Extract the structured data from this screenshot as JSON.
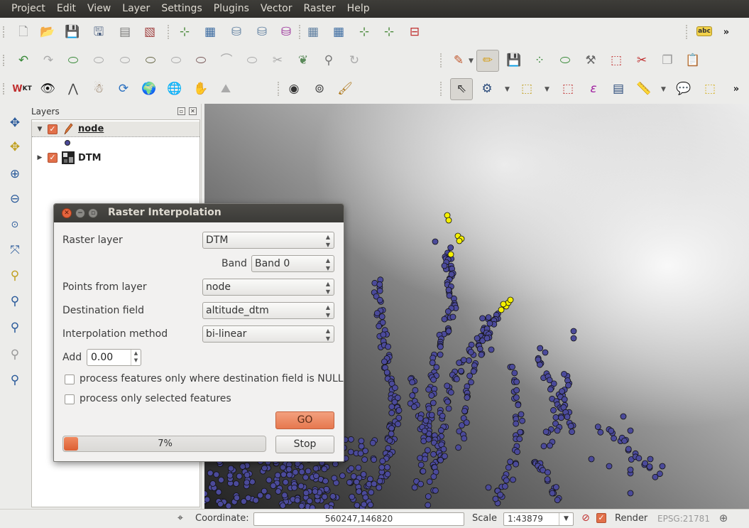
{
  "menubar": {
    "items": [
      "Project",
      "Edit",
      "View",
      "Layer",
      "Settings",
      "Plugins",
      "Vector",
      "Raster",
      "Help"
    ]
  },
  "toolbars": {
    "row1_icons": [
      "new-project-icon",
      "open-project-icon",
      "save-project-icon",
      "save-as-icon",
      "new-print-composer-icon",
      "composer-manager-icon",
      "new-shapefile-layer-icon",
      "add-vector-layer-icon",
      "add-raster-layer-icon",
      "add-postgis-layer-icon",
      "add-spatialite-layer-icon",
      "add-wms-layer-icon",
      "add-wfs-layer-icon",
      "add-delimited-text-icon",
      "new-gpx-layer-icon",
      "remove-layer-icon"
    ],
    "row1_right_icons": [
      "label-tool-icon"
    ],
    "row2_icons": [
      "undo-icon",
      "redo-icon",
      "add-ring-icon",
      "add-part-icon",
      "fill-ring-icon",
      "delete-ring-icon",
      "delete-part-icon",
      "reshape-features-icon",
      "offset-curve-icon",
      "split-features-icon",
      "split-parts-icon",
      "merge-features-icon",
      "merge-attributes-icon",
      "rotate-point-symbols-icon"
    ],
    "row2_right_icons": [
      "current-edits-icon",
      "toggle-editing-icon",
      "save-edits-icon",
      "add-feature-icon",
      "move-feature-icon",
      "node-tool-icon",
      "delete-selected-icon",
      "cut-features-icon",
      "copy-features-icon",
      "paste-features-icon"
    ],
    "row3_icons": [
      "wkt-icon",
      "eye-icon",
      "compass-icon",
      "digitizer-person-icon",
      "refresh-icon",
      "globe-tool-icon",
      "globe-icon",
      "plugin-icon",
      "terrain-icon",
      "gps-icon",
      "rgb-compositor-icon",
      "brush-icon"
    ],
    "row3_right_icons": [
      "identify-icon",
      "run-feature-action-icon",
      "select-features-icon",
      "deselect-icon",
      "select-by-expression-icon",
      "attribute-table-icon",
      "measure-icon",
      "map-tips-icon",
      "new-bookmark-icon"
    ],
    "left_icons": [
      "pan-map-icon",
      "pan-to-selection-icon",
      "zoom-in-icon",
      "zoom-out-icon",
      "zoom-actual-size-icon",
      "zoom-full-icon",
      "zoom-to-selection-icon",
      "zoom-to-layer-icon",
      "zoom-last-icon",
      "zoom-next-icon",
      "refresh-map-icon"
    ],
    "abc_label": "abc"
  },
  "layers_panel": {
    "title": "Layers",
    "layers": [
      {
        "name": "node",
        "checked": true,
        "expanded": true,
        "icon": "pencil-edit-icon"
      },
      {
        "name": "DTM",
        "checked": true,
        "expanded": false,
        "icon": "raster-thumbnail-icon"
      }
    ]
  },
  "dialog": {
    "title": "Raster Interpolation",
    "raster_layer_label": "Raster layer",
    "raster_layer_value": "DTM",
    "band_label": "Band",
    "band_value": "Band 0",
    "points_label": "Points from layer",
    "points_value": "node",
    "dest_field_label": "Destination field",
    "dest_field_value": "altitude_dtm",
    "interp_label": "Interpolation method",
    "interp_value": "bi-linear",
    "add_label": "Add",
    "add_value": "0.00",
    "null_only_label": "process features only where destination field is NULL",
    "null_only_checked": false,
    "selected_only_label": "process only selected features",
    "selected_only_checked": false,
    "go_label": "GO",
    "stop_label": "Stop",
    "progress_value": 0.07,
    "progress_text": "7%"
  },
  "statusbar": {
    "coordinate_label": "Coordinate:",
    "coordinate_value": "560247,146820",
    "scale_label": "Scale",
    "scale_value": "1:43879",
    "render_label": "Render",
    "render_checked": true,
    "crs_label": "EPSG:21781"
  },
  "colors": {
    "point_fill": "#4b4a9a",
    "selected_point_fill": "#f5f000",
    "accent": "#e2704a"
  }
}
